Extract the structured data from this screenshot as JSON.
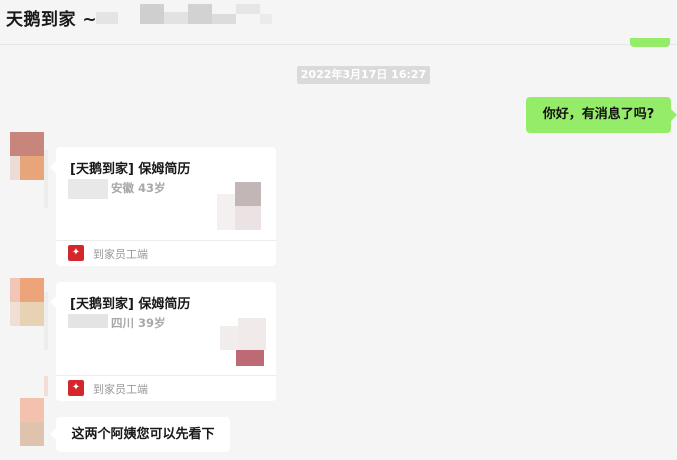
{
  "header": {
    "title": "天鹅到家 ~"
  },
  "timestamp": "2022年3月17日 16:27",
  "messages": {
    "outgoing_1": "你好，有消息了吗?",
    "cards": [
      {
        "title": "[天鹅到家] 保姆简历",
        "meta": "安徽 43岁",
        "app_name": "到家员工端"
      },
      {
        "title": "[天鹅到家] 保姆简历",
        "meta": "四川 39岁",
        "app_name": "到家员工端"
      }
    ],
    "incoming_text": "这两个阿姨您可以先看下"
  },
  "colors": {
    "background": "#f5f5f5",
    "outgoing_bubble": "#95ec69",
    "brand_red": "#d4262d"
  }
}
